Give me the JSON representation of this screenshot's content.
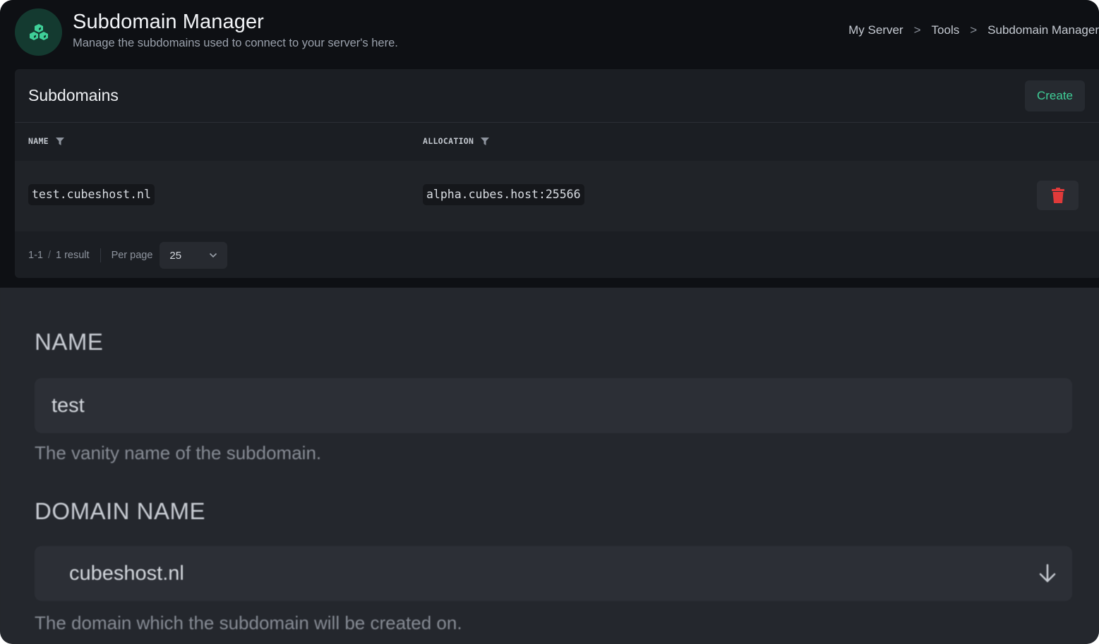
{
  "header": {
    "title": "Subdomain Manager",
    "subtitle": "Manage the subdomains used to connect to your server's here.",
    "logo_icon": "cubes-icon",
    "breadcrumb": [
      "My Server",
      "Tools",
      "Subdomain Manager"
    ],
    "breadcrumb_separator": ">"
  },
  "panel": {
    "title": "Subdomains",
    "create_label": "Create",
    "columns": [
      "NAME",
      "ALLOCATION"
    ],
    "rows": [
      {
        "name": "test.cubeshost.nl",
        "allocation": "alpha.cubes.host:25566"
      }
    ],
    "pagination": {
      "range": "1-1",
      "total": "1 result",
      "per_page_label": "Per page",
      "per_page_value": "25"
    }
  },
  "form": {
    "name_label": "NAME",
    "name_value": "test",
    "name_help": "The vanity name of the subdomain.",
    "domain_label": "DOMAIN NAME",
    "domain_value": "cubeshost.nl",
    "domain_help": "The domain which the subdomain will be created on."
  },
  "colors": {
    "accent": "#3fcf98",
    "danger": "#e03a3a",
    "background": "#0e1014",
    "panel": "#1b1e23"
  }
}
